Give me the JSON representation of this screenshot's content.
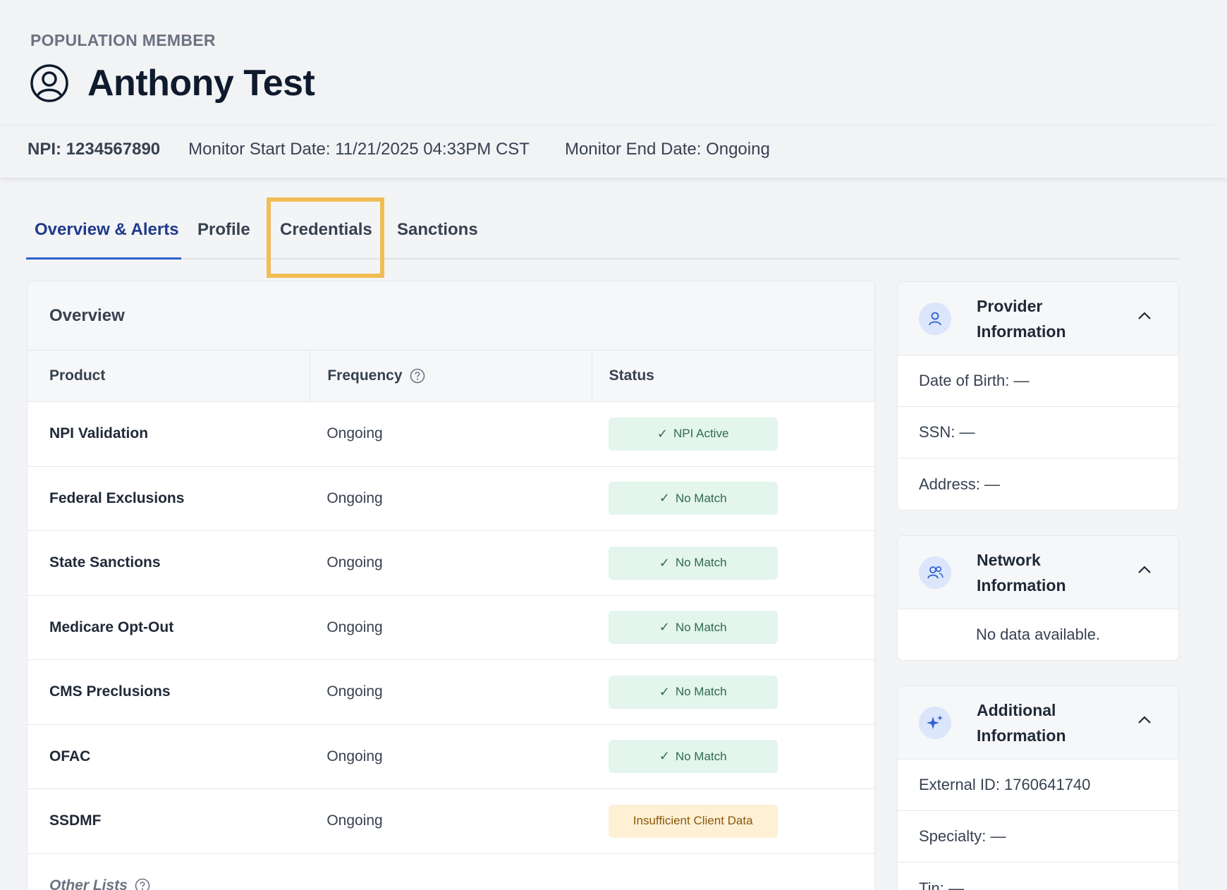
{
  "header": {
    "eyebrow": "POPULATION MEMBER",
    "name": "Anthony Test",
    "avatar_icon": "user-circle-icon",
    "npi": "NPI: 1234567890",
    "monitor_start": "Monitor Start Date: 11/21/2025 04:33PM CST",
    "monitor_end": "Monitor End Date: Ongoing"
  },
  "tabs": [
    {
      "label": "Overview & Alerts",
      "active": true
    },
    {
      "label": "Profile",
      "active": false
    },
    {
      "label": "Credentials",
      "active": false,
      "highlighted": true
    },
    {
      "label": "Sanctions",
      "active": false
    }
  ],
  "overview": {
    "title": "Overview",
    "columns": {
      "product": "Product",
      "frequency": "Frequency",
      "status": "Status"
    },
    "rows": [
      {
        "product": "NPI Validation",
        "frequency": "Ongoing",
        "status": "NPI Active",
        "status_type": "ok"
      },
      {
        "product": "Federal Exclusions",
        "frequency": "Ongoing",
        "status": "No Match",
        "status_type": "ok"
      },
      {
        "product": "State Sanctions",
        "frequency": "Ongoing",
        "status": "No Match",
        "status_type": "ok"
      },
      {
        "product": "Medicare Opt-Out",
        "frequency": "Ongoing",
        "status": "No Match",
        "status_type": "ok"
      },
      {
        "product": "CMS Preclusions",
        "frequency": "Ongoing",
        "status": "No Match",
        "status_type": "ok"
      },
      {
        "product": "OFAC",
        "frequency": "Ongoing",
        "status": "No Match",
        "status_type": "ok"
      },
      {
        "product": "SSDMF",
        "frequency": "Ongoing",
        "status": "Insufficient Client Data",
        "status_type": "warn"
      }
    ],
    "other_lists": "Other Lists"
  },
  "provider_info": {
    "title_line1": "Provider",
    "title_line2": "Information",
    "rows": [
      "Date of Birth: —",
      "SSN: —",
      "Address: —"
    ]
  },
  "network_info": {
    "title_line1": "Network",
    "title_line2": "Information",
    "empty": "No data available."
  },
  "additional_info": {
    "title_line1": "Additional",
    "title_line2": "Information",
    "rows": [
      "External ID: 1760641740",
      "Specialty: —",
      "Tin: —"
    ]
  },
  "colors": {
    "accent": "#2f5fd0",
    "highlight": "#f0bd55",
    "ok_bg": "#e3f5ec",
    "warn_bg": "#fdf0d5"
  }
}
